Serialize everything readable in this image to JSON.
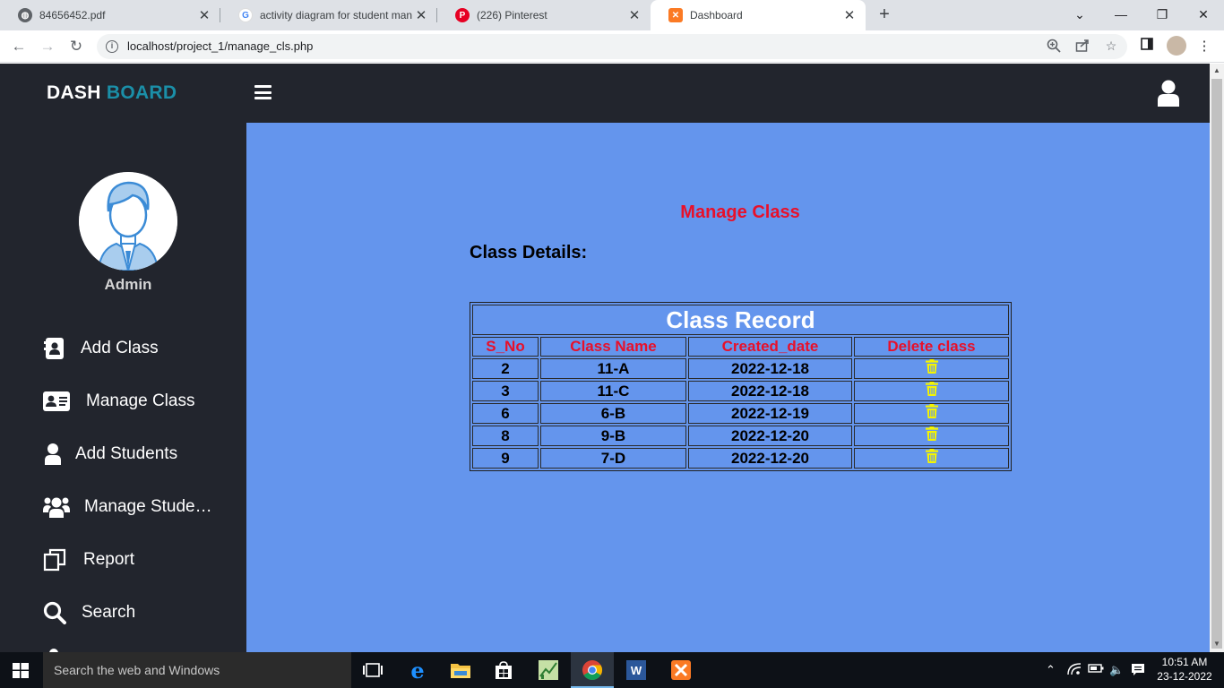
{
  "browser": {
    "tabs": [
      {
        "title": "84656452.pdf"
      },
      {
        "title": "activity diagram for student man"
      },
      {
        "title": "(226) Pinterest"
      },
      {
        "title": "Dashboard"
      }
    ],
    "url": "localhost/project_1/manage_cls.php"
  },
  "app": {
    "brand_part1": "DASH",
    "brand_part2": "BOARD",
    "admin_name": "Admin",
    "menu": [
      {
        "label": "Add Class",
        "icon": "address-book-icon"
      },
      {
        "label": "Manage Class",
        "icon": "id-card-icon"
      },
      {
        "label": "Add Students",
        "icon": "user-icon"
      },
      {
        "label": "Manage Stude…",
        "icon": "users-icon"
      },
      {
        "label": "Report",
        "icon": "copy-icon"
      },
      {
        "label": "Search",
        "icon": "search-icon"
      }
    ]
  },
  "main": {
    "title": "Manage Class",
    "section": "Class Details:",
    "table": {
      "caption": "Class Record",
      "headers": [
        "S_No",
        "Class Name",
        "Created_date",
        "Delete class"
      ],
      "rows": [
        {
          "s_no": "2",
          "class_name": "11-A",
          "created_date": "2022-12-18"
        },
        {
          "s_no": "3",
          "class_name": "11-C",
          "created_date": "2022-12-18"
        },
        {
          "s_no": "6",
          "class_name": "6-B",
          "created_date": "2022-12-19"
        },
        {
          "s_no": "8",
          "class_name": "9-B",
          "created_date": "2022-12-20"
        },
        {
          "s_no": "9",
          "class_name": "7-D",
          "created_date": "2022-12-20"
        }
      ]
    }
  },
  "taskbar": {
    "search_placeholder": "Search the web and Windows",
    "time": "10:51 AM",
    "date": "23-12-2022"
  },
  "colors": {
    "sidebar_bg": "#22252d",
    "main_bg": "#6495ed",
    "title_red": "#e8102a",
    "brand_accent": "#1b8fa8",
    "trash_yellow": "#f5f500"
  }
}
